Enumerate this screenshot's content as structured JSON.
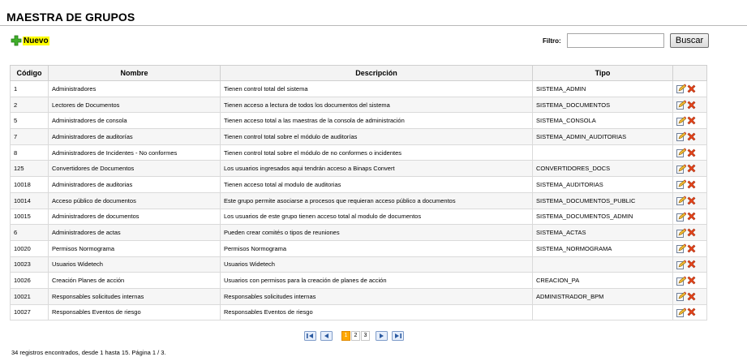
{
  "page": {
    "title": "MAESTRA DE GRUPOS"
  },
  "toolbar": {
    "new_label": "Nuevo",
    "filter_label": "Filtro:",
    "filter_value": "",
    "search_label": "Buscar"
  },
  "table": {
    "columns": [
      "Código",
      "Nombre",
      "Descripción",
      "Tipo",
      ""
    ],
    "rows": [
      {
        "codigo": "1",
        "nombre": "Administradores",
        "descripcion": "Tienen control total del sistema",
        "tipo": "SISTEMA_ADMIN"
      },
      {
        "codigo": "2",
        "nombre": "Lectores de Documentos",
        "descripcion": "Tienen acceso a lectura de todos los documentos del sistema",
        "tipo": "SISTEMA_DOCUMENTOS"
      },
      {
        "codigo": "5",
        "nombre": "Administradores de consola",
        "descripcion": "Tienen acceso total a las maestras de la consola de administración",
        "tipo": "SISTEMA_CONSOLA"
      },
      {
        "codigo": "7",
        "nombre": "Administradores de auditorías",
        "descripcion": "Tienen control total sobre el módulo de auditorías",
        "tipo": "SISTEMA_ADMIN_AUDITORIAS"
      },
      {
        "codigo": "8",
        "nombre": "Administradores de Incidentes - No conformes",
        "descripcion": "Tienen control total sobre el módulo de no conformes o incidentes",
        "tipo": ""
      },
      {
        "codigo": "125",
        "nombre": "Convertidores de Documentos",
        "descripcion": "Los usuarios ingresados aqui tendrán acceso a Binaps Convert",
        "tipo": "CONVERTIDORES_DOCS"
      },
      {
        "codigo": "10018",
        "nombre": "Administradores de auditorias",
        "descripcion": "Tienen acceso total al modulo de auditorias",
        "tipo": "SISTEMA_AUDITORIAS"
      },
      {
        "codigo": "10014",
        "nombre": "Acceso público de documentos",
        "descripcion": "Este grupo permite asociarse a procesos que requieran acceso público a documentos",
        "tipo": "SISTEMA_DOCUMENTOS_PUBLIC"
      },
      {
        "codigo": "10015",
        "nombre": "Administradores de documentos",
        "descripcion": "Los usuarios de este grupo tienen acceso total al modulo de documentos",
        "tipo": "SISTEMA_DOCUMENTOS_ADMIN"
      },
      {
        "codigo": "6",
        "nombre": "Administradores de actas",
        "descripcion": "Pueden crear comités o tipos de reuniones",
        "tipo": "SISTEMA_ACTAS"
      },
      {
        "codigo": "10020",
        "nombre": "Permisos Normograma",
        "descripcion": "Permisos Normograma",
        "tipo": "SISTEMA_NORMOGRAMA"
      },
      {
        "codigo": "10023",
        "nombre": "Usuarios Widetech",
        "descripcion": "Usuarios Widetech",
        "tipo": ""
      },
      {
        "codigo": "10026",
        "nombre": "Creación Planes de acción",
        "descripcion": "Usuarios con permisos para la creación de planes de acción",
        "tipo": "CREACION_PA"
      },
      {
        "codigo": "10021",
        "nombre": "Responsables solicitudes internas",
        "descripcion": "Responsables solicitudes internas",
        "tipo": "ADMINISTRADOR_BPM"
      },
      {
        "codigo": "10027",
        "nombre": "Responsables Eventos de riesgo",
        "descripcion": "Responsables Eventos de riesgo",
        "tipo": ""
      }
    ]
  },
  "pagination": {
    "pages": [
      "1",
      "2",
      "3"
    ],
    "current": "1"
  },
  "footer": {
    "records_text": "34 registros encontrados, desde 1 hasta 15. Página 1 / 3."
  },
  "icons": {
    "new": "plus-icon",
    "edit": "edit-icon",
    "delete": "delete-icon",
    "first": "first-page-icon",
    "prev": "prev-page-icon",
    "next": "next-page-icon",
    "last": "last-page-icon"
  },
  "colors": {
    "new_highlight": "#ffff00",
    "plus_green": "#3fae2a",
    "delete_red": "#e8461c",
    "page_active": "#ffa800",
    "pager_blue": "#2c5aa0"
  }
}
